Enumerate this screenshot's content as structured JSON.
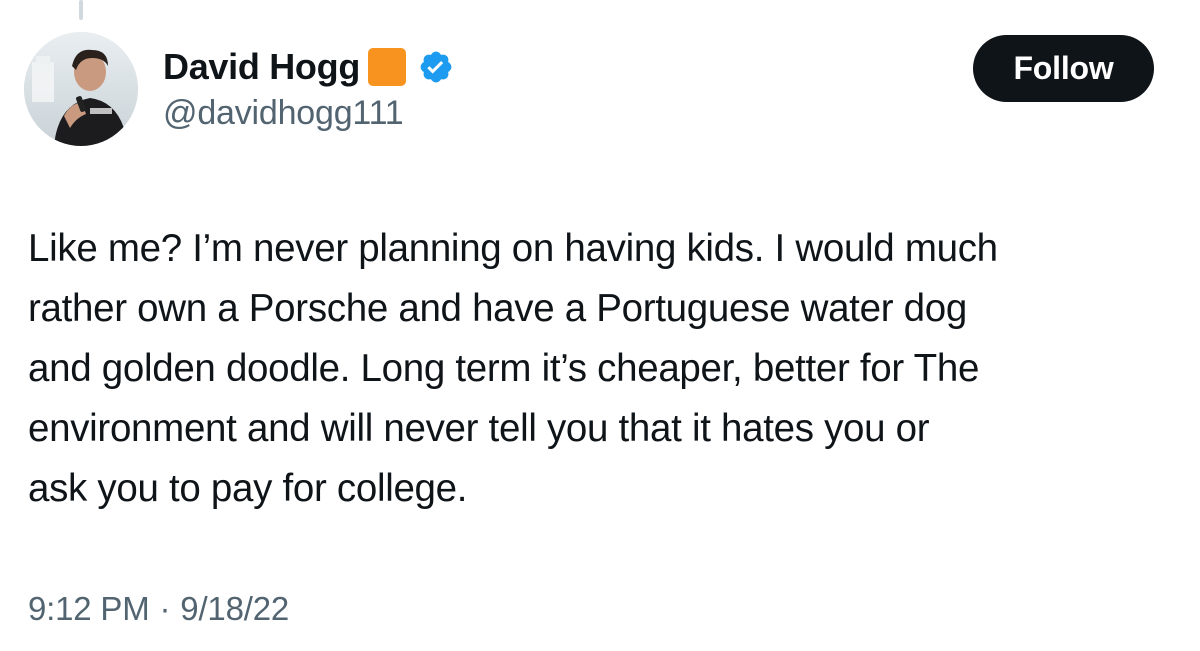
{
  "colors": {
    "text_primary": "#0f1419",
    "text_secondary": "#536471",
    "follow_bg": "#0f1419",
    "verified_blue": "#1d9bf0",
    "emoji_orange": "#f7931e"
  },
  "author": {
    "display_name": "David Hogg",
    "handle": "@davidhogg111",
    "badge_emoji": "orange-square",
    "verified_icon": "verified-badge-icon",
    "avatar_icon": "profile-photo"
  },
  "follow_button": {
    "label": "Follow"
  },
  "tweet": {
    "lines": [
      "Like me? I’m never planning on having kids. I would much",
      "rather own a Porsche and have a Portuguese water dog",
      "and golden doodle. Long term it’s cheaper, better for The",
      "environment and will never tell you that it hates you or",
      "ask you to pay for college."
    ],
    "time": "9:12 PM",
    "separator": "·",
    "date": "9/18/22"
  }
}
